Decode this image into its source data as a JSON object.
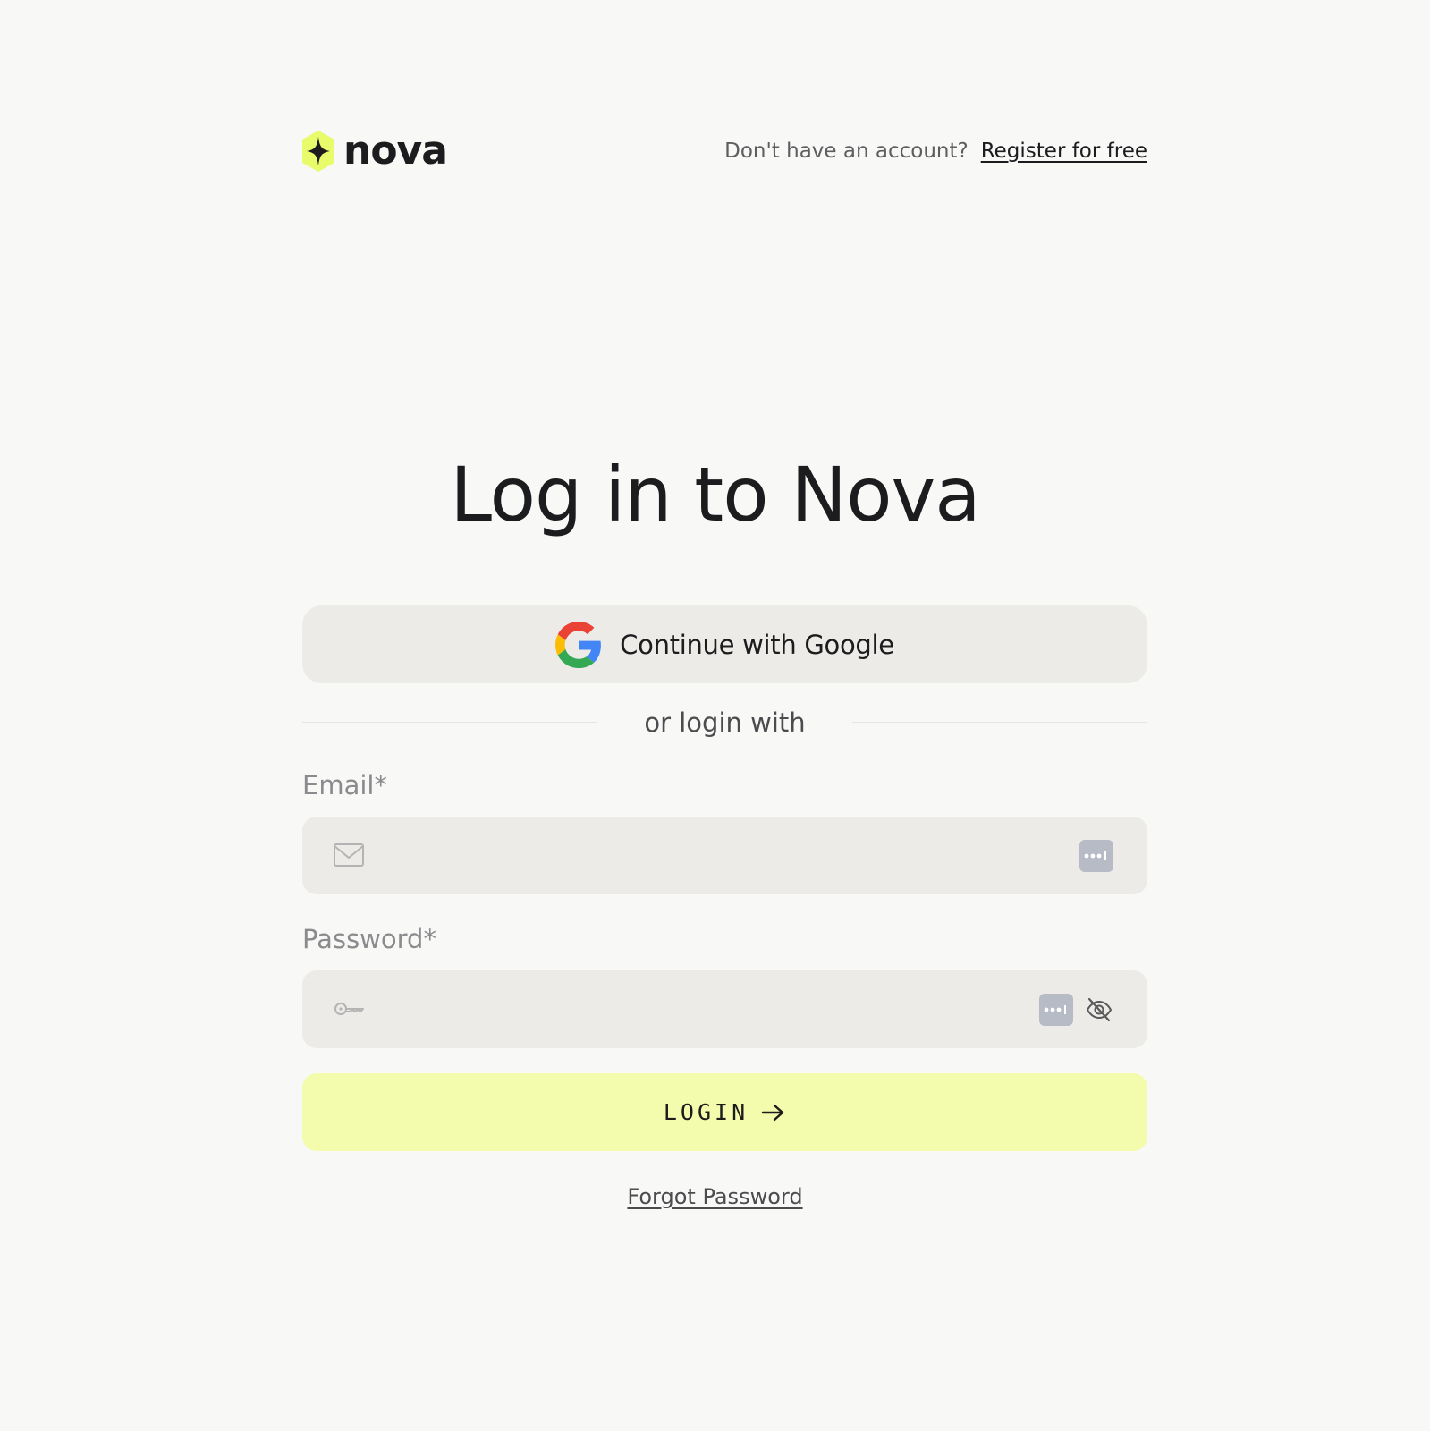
{
  "brand": {
    "name": "nova",
    "accent_color": "#e8fb6a"
  },
  "header": {
    "prompt": "Don't have an account?",
    "register_link": "Register for free"
  },
  "title": "Log in to Nova",
  "google_button": {
    "label": "Continue with Google",
    "icon": "google-icon"
  },
  "divider_text": "or login with",
  "email": {
    "label": "Email*",
    "value": "",
    "placeholder": "",
    "icon": "mail-icon"
  },
  "password": {
    "label": "Password*",
    "value": "",
    "placeholder": "",
    "icon": "key-icon",
    "toggle_icon": "eye-off-icon"
  },
  "login_button": {
    "label": "LOGIN",
    "icon": "arrow-right-icon",
    "color": "#f3fcac"
  },
  "forgot_link": "Forgot Password"
}
